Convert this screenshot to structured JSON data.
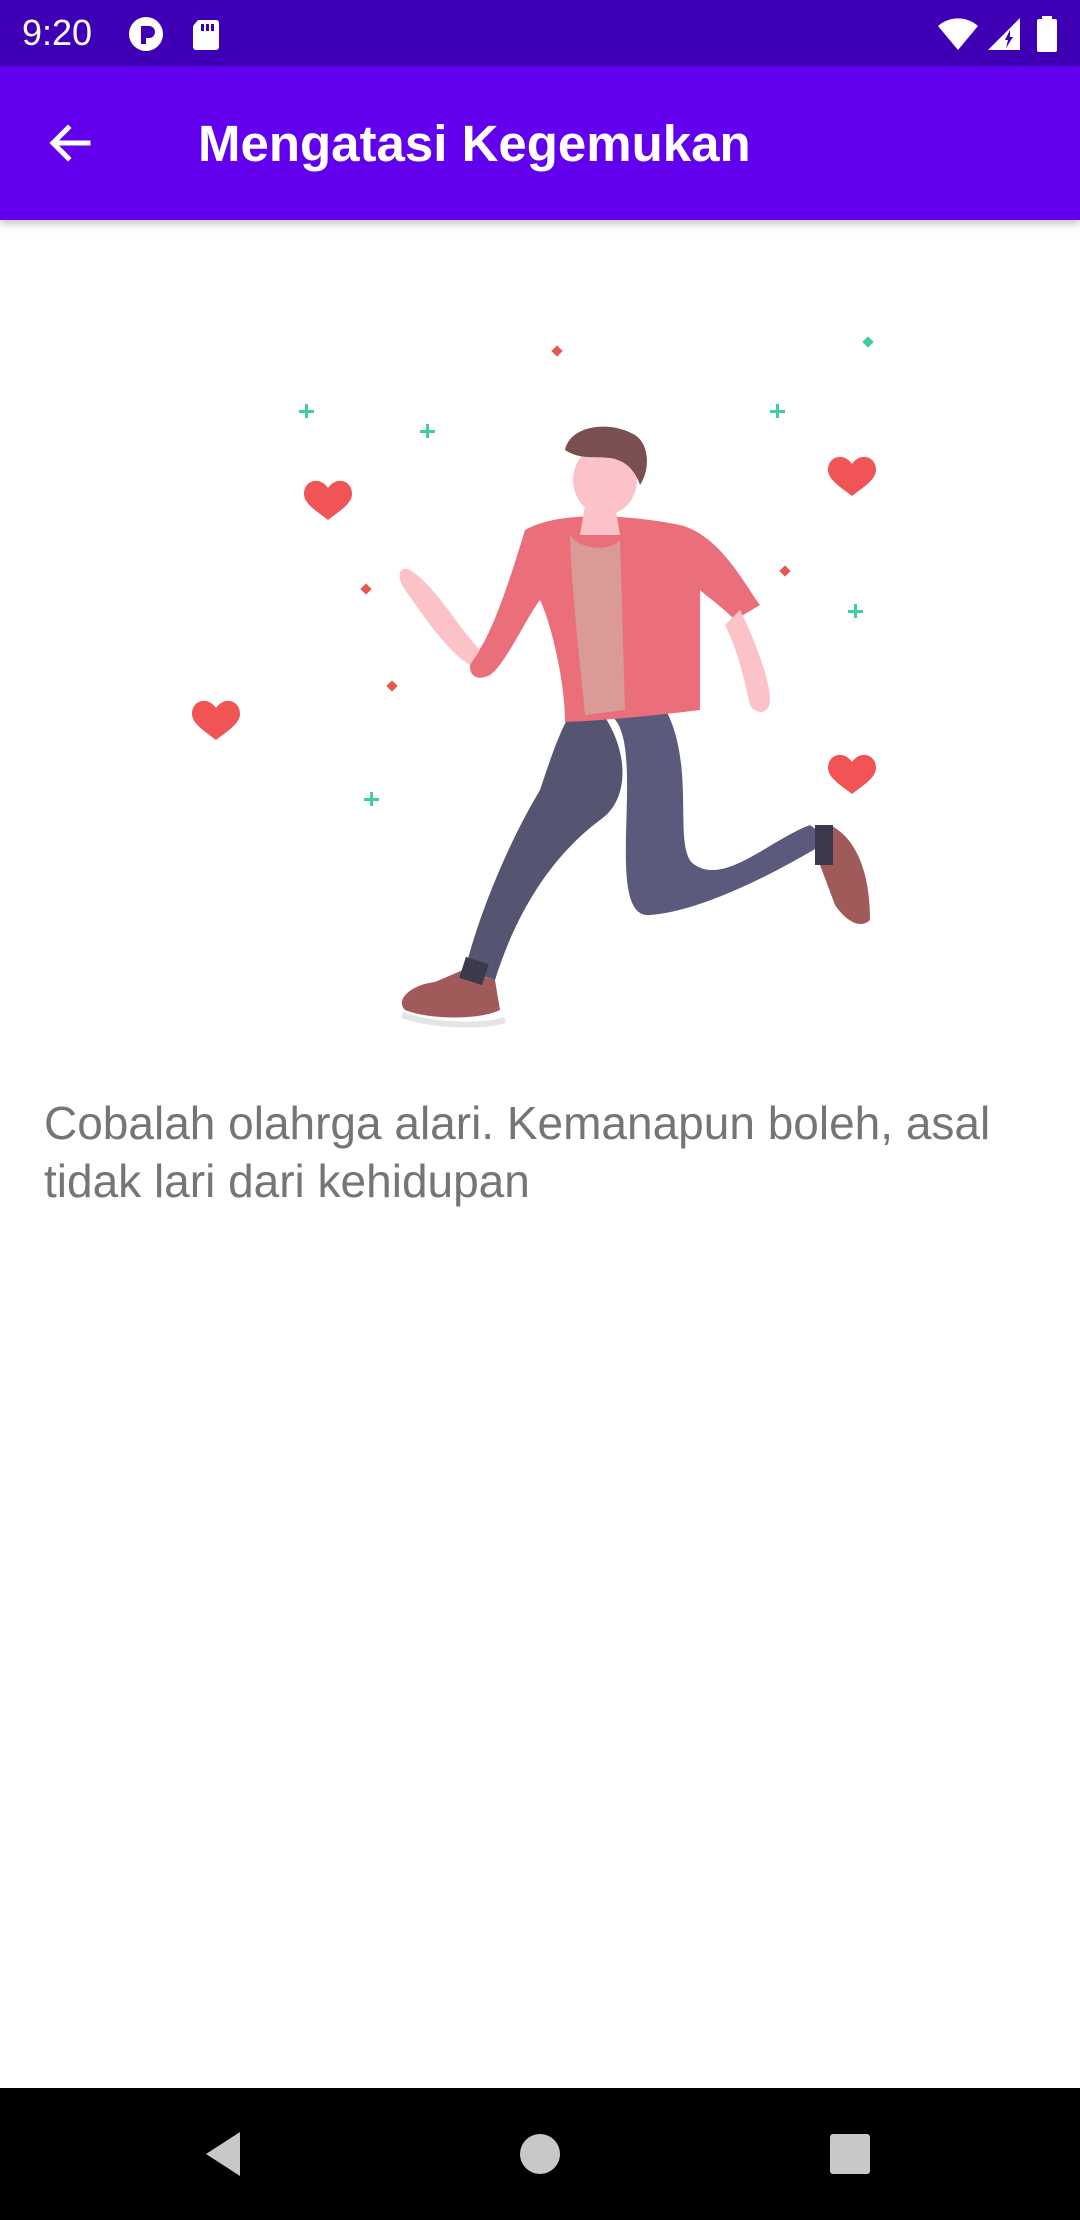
{
  "status_bar": {
    "time": "9:20",
    "icons": [
      "pocket-casts-icon",
      "sd-card-icon",
      "wifi-icon",
      "cell-signal-icon",
      "battery-icon"
    ],
    "background": "#3f00b5"
  },
  "app_bar": {
    "title": "Mengatasi Kegemukan",
    "back_icon": "arrow-left-icon",
    "background": "#6200ee"
  },
  "content": {
    "illustration": "running-person-illustration",
    "text": "Cobalah olahrga alari. Kemanapun boleh, asal tidak lari dari kehidupan"
  },
  "nav_bar": {
    "buttons": [
      "back-triangle-icon",
      "home-circle-icon",
      "recents-square-icon"
    ]
  },
  "colors": {
    "primary": "#6200ee",
    "primary_dark": "#3f00b5",
    "text_secondary": "#757575",
    "heart": "#f05454",
    "sparkle_green": "#3fcf9a"
  }
}
